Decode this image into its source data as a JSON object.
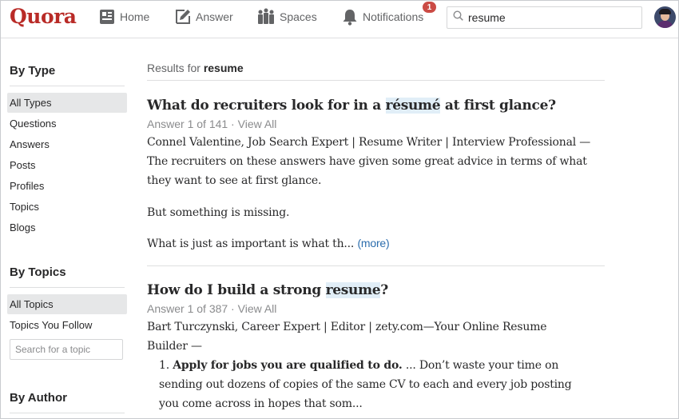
{
  "header": {
    "logo": "Quora",
    "nav": [
      {
        "label": "Home",
        "icon": "home-icon"
      },
      {
        "label": "Answer",
        "icon": "answer-pencil-icon"
      },
      {
        "label": "Spaces",
        "icon": "spaces-icon"
      },
      {
        "label": "Notifications",
        "icon": "bell-icon"
      }
    ],
    "notifications_badge": "1",
    "search_value": "resume"
  },
  "sidebar": {
    "by_type": {
      "heading": "By Type",
      "items": [
        "All Types",
        "Questions",
        "Answers",
        "Posts",
        "Profiles",
        "Topics",
        "Blogs"
      ],
      "selected": "All Types"
    },
    "by_topics": {
      "heading": "By Topics",
      "items": [
        "All Topics",
        "Topics You Follow"
      ],
      "selected": "All Topics",
      "search_placeholder": "Search for a topic"
    },
    "by_author": {
      "heading": "By Author"
    }
  },
  "main": {
    "results_prefix": "Results for",
    "query": "resume",
    "results": [
      {
        "title_before": "What do recruiters look for in a",
        "title_highlight": "résumé",
        "title_after": "at first glance?",
        "meta_answer": "Answer 1 of 141",
        "meta_view_all": "View All",
        "author": "Connel Valentine, Job Search Expert | Resume Writer | Interview Professional —",
        "text_1": "The recruiters on these answers have given some great advice in terms of what they want to see at first glance.",
        "text_2": "But something is missing.",
        "text_3": "What is just as important is what th...",
        "more": "(more)"
      },
      {
        "title_before": "How do I build a strong",
        "title_highlight": "resume",
        "title_after": "?",
        "meta_answer": "Answer 1 of 387",
        "meta_view_all": "View All",
        "author": "Bart Turczynski, Career Expert | Editor | zety.com—Your Online Resume Builder —",
        "list_number": "1.",
        "list_bold": "Apply for jobs you are qualified to do.",
        "list_text": "... Don’t waste your time on sending out dozens of copies of the same CV to each and every job posting you come across in hopes that som..."
      }
    ]
  }
}
